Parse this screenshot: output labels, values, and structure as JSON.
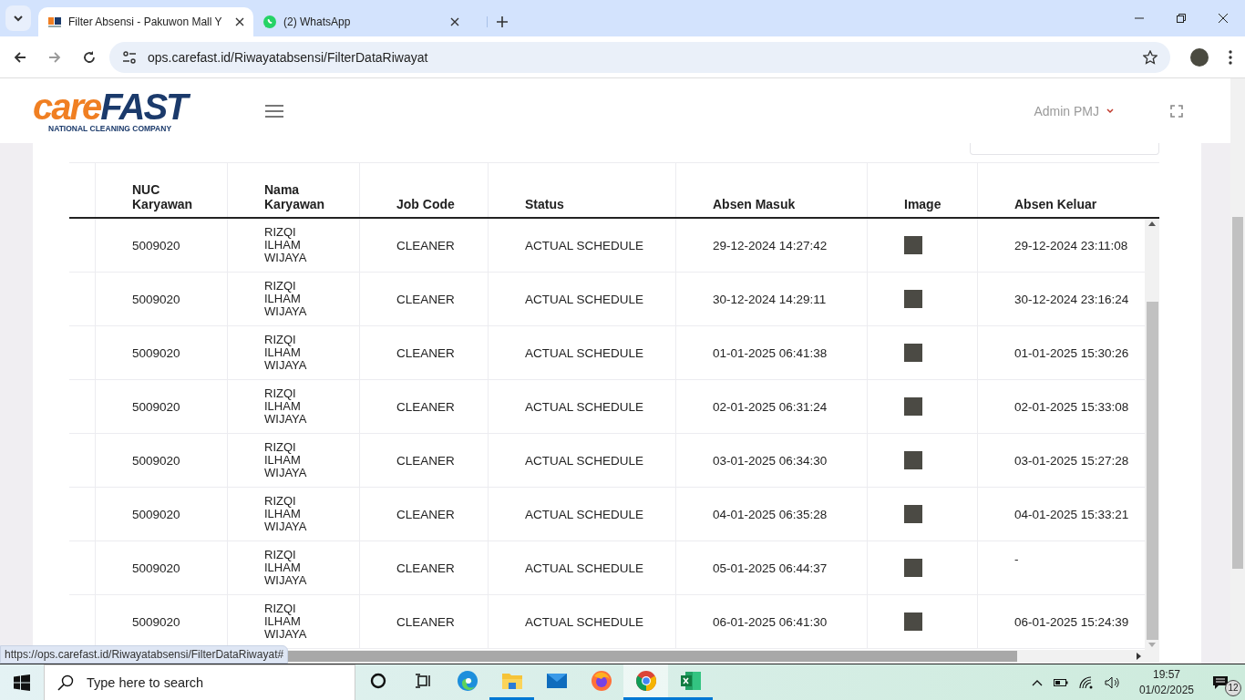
{
  "browser": {
    "tabs": [
      {
        "kind": "site",
        "title": "Filter Absensi - Pakuwon Mall Y",
        "selected": true
      },
      {
        "kind": "whatsapp",
        "title": "(2) WhatsApp",
        "selected": false
      }
    ],
    "url": "ops.carefast.id/Riwayatabsensi/FilterDataRiwayat",
    "status_url": "https://ops.carefast.id/Riwayatabsensi/FilterDataRiwayat#"
  },
  "header": {
    "logo": {
      "part_1": "care",
      "part_2": "FAST",
      "tagline": "NATIONAL CLEANING COMPANY"
    },
    "user": "Admin PMJ"
  },
  "table": {
    "columns": [
      "NUC Karyawan",
      "Nama Karyawan",
      "Job Code",
      "Status",
      "Absen Masuk",
      "Image",
      "Absen Keluar"
    ],
    "rows": [
      {
        "nuc": "5009020",
        "name": "RIZQI ILHAM WIJAYA",
        "job_code": "CLEANER",
        "status": "ACTUAL SCHEDULE",
        "absen_masuk": "29-12-2024 14:27:42",
        "absen_keluar": "29-12-2024 23:11:08"
      },
      {
        "nuc": "5009020",
        "name": "RIZQI ILHAM WIJAYA",
        "job_code": "CLEANER",
        "status": "ACTUAL SCHEDULE",
        "absen_masuk": "30-12-2024 14:29:11",
        "absen_keluar": "30-12-2024 23:16:24"
      },
      {
        "nuc": "5009020",
        "name": "RIZQI ILHAM WIJAYA",
        "job_code": "CLEANER",
        "status": "ACTUAL SCHEDULE",
        "absen_masuk": "01-01-2025 06:41:38",
        "absen_keluar": "01-01-2025 15:30:26"
      },
      {
        "nuc": "5009020",
        "name": "RIZQI ILHAM WIJAYA",
        "job_code": "CLEANER",
        "status": "ACTUAL SCHEDULE",
        "absen_masuk": "02-01-2025 06:31:24",
        "absen_keluar": "02-01-2025 15:33:08"
      },
      {
        "nuc": "5009020",
        "name": "RIZQI ILHAM WIJAYA",
        "job_code": "CLEANER",
        "status": "ACTUAL SCHEDULE",
        "absen_masuk": "03-01-2025 06:34:30",
        "absen_keluar": "03-01-2025 15:27:28"
      },
      {
        "nuc": "5009020",
        "name": "RIZQI ILHAM WIJAYA",
        "job_code": "CLEANER",
        "status": "ACTUAL SCHEDULE",
        "absen_masuk": "04-01-2025 06:35:28",
        "absen_keluar": "04-01-2025 15:33:21"
      },
      {
        "nuc": "5009020",
        "name": "RIZQI ILHAM WIJAYA",
        "job_code": "CLEANER",
        "status": "ACTUAL SCHEDULE",
        "absen_masuk": "05-01-2025 06:44:37",
        "absen_keluar": "-"
      },
      {
        "nuc": "5009020",
        "name": "RIZQI ILHAM WIJAYA",
        "job_code": "CLEANER",
        "status": "ACTUAL SCHEDULE",
        "absen_masuk": "06-01-2025 06:41:30",
        "absen_keluar": "06-01-2025 15:24:39"
      }
    ]
  },
  "taskbar": {
    "search_placeholder": "Type here to search",
    "apps": [
      {
        "kind": "cortana",
        "running": false,
        "selected": false
      },
      {
        "kind": "taskview",
        "running": false,
        "selected": false
      },
      {
        "kind": "edge",
        "running": false,
        "selected": false
      },
      {
        "kind": "explorer",
        "running": true,
        "selected": false
      },
      {
        "kind": "mail",
        "running": false,
        "selected": false
      },
      {
        "kind": "firefox",
        "running": false,
        "selected": false
      },
      {
        "kind": "chrome",
        "running": true,
        "selected": true
      },
      {
        "kind": "excel",
        "running": true,
        "selected": false
      }
    ],
    "time": "19:57",
    "date": "01/02/2025",
    "notification_count": "12"
  }
}
